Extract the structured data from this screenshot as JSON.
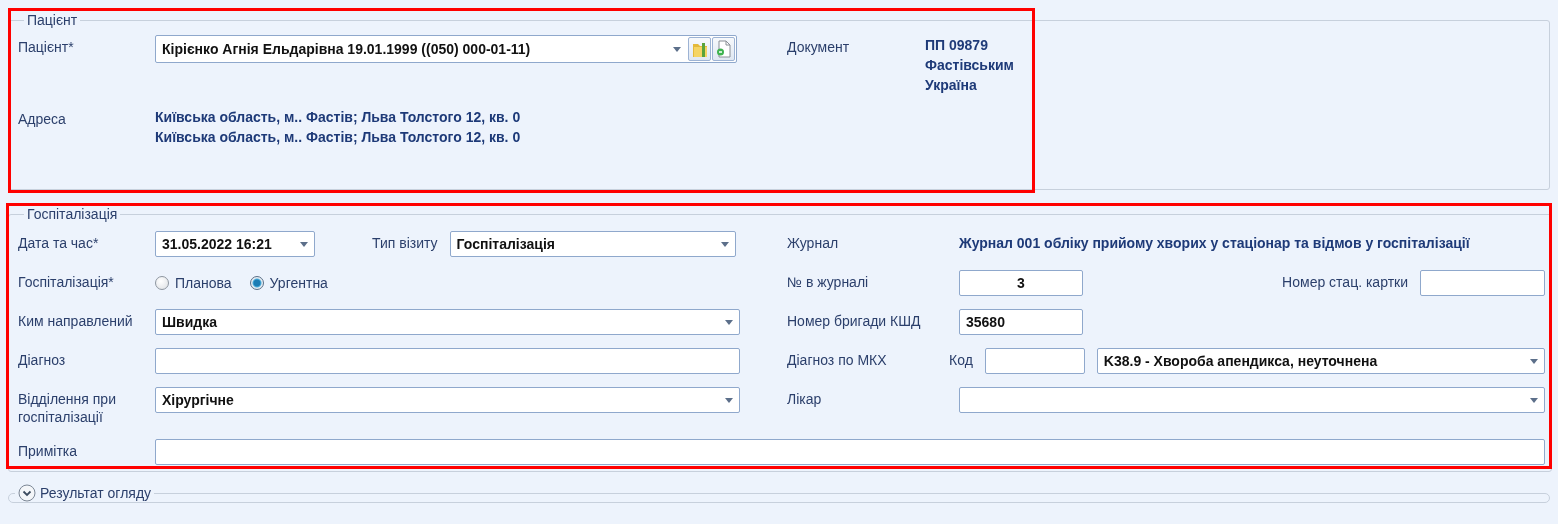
{
  "patient": {
    "legend": "Пацієнт",
    "highlighted": true,
    "patient_label": "Пацієнт*",
    "patient_value": "Кірієнко Агнія Ельдарівна 19.01.1999 ((050) 000-01-11)",
    "address_label": "Адреса",
    "address_lines": [
      "Київська область, м.. Фастів; Льва Толстого 12, кв. 0",
      "Київська область, м.. Фастів; Льва Толстого 12, кв. 0"
    ],
    "document_label": "Документ",
    "document_lines": [
      "ПП 09879",
      "Фастівським",
      "Україна"
    ]
  },
  "hospitalization": {
    "legend": "Госпіталізація",
    "highlighted": true,
    "date_label": "Дата та час*",
    "date_value": "31.05.2022 16:21",
    "visit_type_label": "Тип візиту",
    "visit_type_value": "Госпіталізація",
    "hosp_label": "Госпіталізація*",
    "hosp_options": [
      {
        "label": "Планова",
        "selected": false
      },
      {
        "label": "Ургентна",
        "selected": true
      }
    ],
    "referred_label": "Ким направлений",
    "referred_value": "Швидка",
    "diagnosis_label": "Діагноз",
    "department_label": "Відділення при госпіталізації",
    "department_value": "Хірургічне",
    "note_label": "Примітка",
    "journal_label": "Журнал",
    "journal_value": "Журнал 001 обліку прийому хворих у стаціонар та відмов у госпіталізації",
    "journal_no_label": "№ в журналі",
    "journal_no_value": "3",
    "card_no_label": "Номер стац. картки",
    "brigade_label": "Номер бригади КШД",
    "brigade_value": "35680",
    "icd_label": "Діагноз по МКХ",
    "code_label": "Код",
    "icd_value": "K38.9 - Хвороба апендикса, неуточнена",
    "doctor_label": "Лікар"
  },
  "exam_result": {
    "legend": "Результат огляду",
    "expanded": false
  }
}
